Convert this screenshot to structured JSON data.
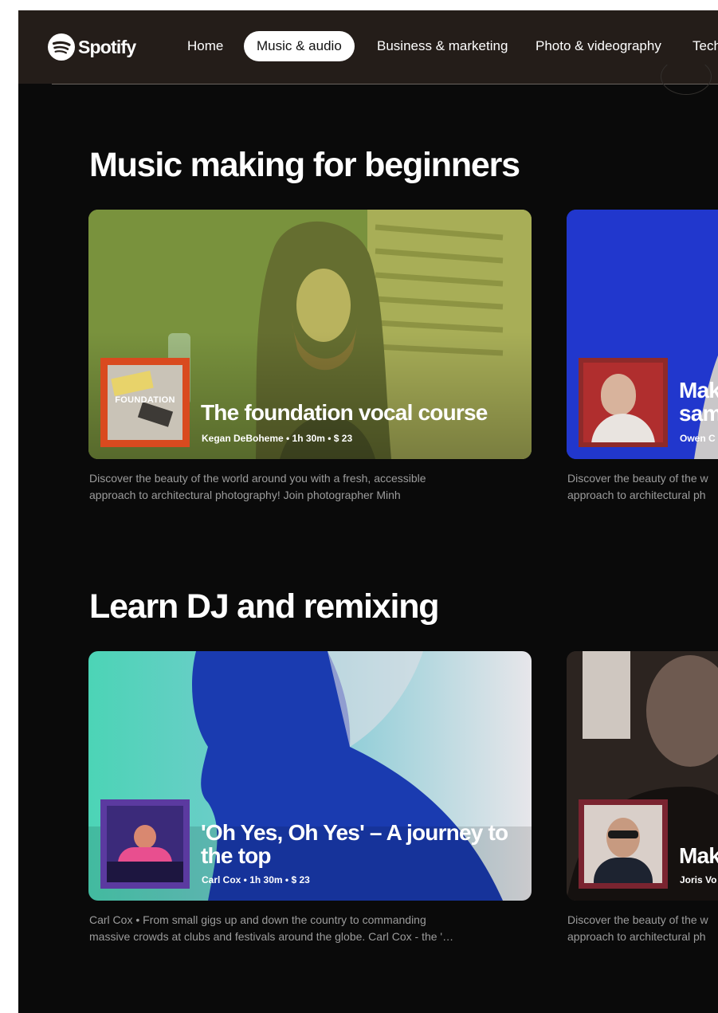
{
  "header": {
    "brand": "Spotify",
    "nav": [
      {
        "label": "Home",
        "active": false
      },
      {
        "label": "Music & audio",
        "active": true
      },
      {
        "label": "Business & marketing",
        "active": false
      },
      {
        "label": "Photo & videography",
        "active": false
      },
      {
        "label": "Tech",
        "active": false
      }
    ]
  },
  "sections": [
    {
      "title": "Music making for beginners",
      "cards": [
        {
          "title_lines": [
            "The foundation vocal course"
          ],
          "meta": "Kegan DeBoheme  • 1h 30m  •  $ 23",
          "thumb_text": "FOUNDATION",
          "description_lines": [
            "Discover the beauty of the world around you with a fresh, accessible",
            "approach to architectural photography! Join photographer Minh"
          ]
        },
        {
          "title_lines": [
            "Mak",
            "sam"
          ],
          "meta": "Owen C",
          "description_lines": [
            "Discover the beauty of the w",
            "approach to architectural ph"
          ]
        }
      ]
    },
    {
      "title": "Learn DJ and remixing",
      "cards": [
        {
          "title_lines": [
            "'Oh Yes, Oh Yes' – A journey to",
            "the top"
          ],
          "meta": "Carl Cox  • 1h 30m  •  $ 23",
          "description_lines": [
            "Carl Cox • From small gigs up and down the country to commanding",
            "massive crowds at clubs and festivals around the globe. Carl Cox - the '…"
          ]
        },
        {
          "title_lines": [
            "Mak"
          ],
          "meta": "Joris Vo",
          "description_lines": [
            "Discover the beauty of the w",
            "approach to architectural ph"
          ]
        }
      ]
    }
  ],
  "colors": {
    "background": "#0a0a0a",
    "header": "#241d19",
    "text": "#ffffff",
    "muted_text": "#9c9c9c"
  }
}
